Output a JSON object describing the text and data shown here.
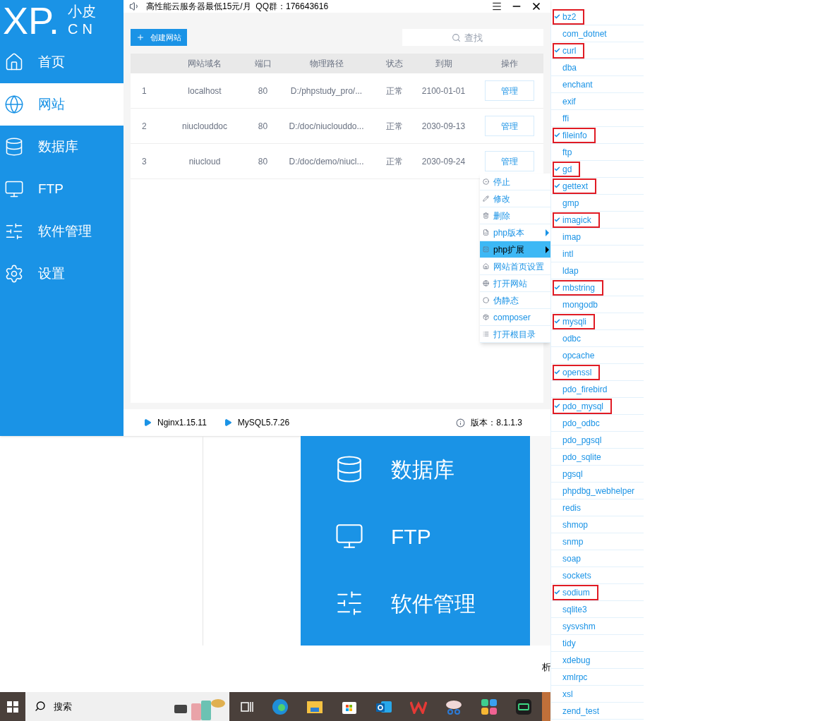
{
  "app": {
    "logo": {
      "mark": "XP.",
      "name": "小皮",
      "domain": "CN"
    },
    "notice": "高性能云服务器最低15元/月  QQ群：176643616",
    "sidebar": {
      "items": [
        {
          "label": "首页",
          "selected": false
        },
        {
          "label": "网站",
          "selected": true
        },
        {
          "label": "数据库",
          "selected": false
        },
        {
          "label": "FTP",
          "selected": false
        },
        {
          "label": "软件管理",
          "selected": false
        },
        {
          "label": "设置",
          "selected": false
        }
      ]
    },
    "toolbar": {
      "create_button": "创建网站",
      "search": {
        "placeholder": "查找"
      }
    },
    "table": {
      "columns": [
        "网站域名",
        "端口",
        "物理路径",
        "状态",
        "到期",
        "操作"
      ],
      "rows": [
        {
          "index": "1",
          "domain": "localhost",
          "port": "80",
          "path": "D:/phpstudy_pro/...",
          "status": "正常",
          "expires": "2100-01-01",
          "action": "管理"
        },
        {
          "index": "2",
          "domain": "niuclouddoc",
          "port": "80",
          "path": "D:/doc/niuclouddo...",
          "status": "正常",
          "expires": "2030-09-13",
          "action": "管理"
        },
        {
          "index": "3",
          "domain": "niucloud",
          "port": "80",
          "path": "D:/doc/demo/niucl...",
          "status": "正常",
          "expires": "2030-09-24",
          "action": "管理"
        }
      ]
    },
    "context_menu": {
      "items": [
        {
          "label": "停止",
          "selected": false,
          "submenu": false
        },
        {
          "label": "修改",
          "selected": false,
          "submenu": false
        },
        {
          "label": "删除",
          "selected": false,
          "submenu": false
        },
        {
          "label": "php版本",
          "selected": false,
          "submenu": true
        },
        {
          "label": "php扩展",
          "selected": true,
          "submenu": true
        },
        {
          "label": "网站首页设置",
          "selected": false,
          "submenu": false
        },
        {
          "label": "打开网站",
          "selected": false,
          "submenu": false
        },
        {
          "label": "伪静态",
          "selected": false,
          "submenu": false
        },
        {
          "label": "composer",
          "selected": false,
          "submenu": false
        },
        {
          "label": "打开根目录",
          "selected": false,
          "submenu": false
        }
      ]
    },
    "status_bar": {
      "services": [
        "Nginx1.15.11",
        "MySQL5.7.26"
      ],
      "version": "版本：8.1.1.3"
    }
  },
  "extensions_menu": {
    "items": [
      {
        "name": "bz2",
        "checked": true
      },
      {
        "name": "com_dotnet",
        "checked": false
      },
      {
        "name": "curl",
        "checked": true
      },
      {
        "name": "dba",
        "checked": false
      },
      {
        "name": "enchant",
        "checked": false
      },
      {
        "name": "exif",
        "checked": false
      },
      {
        "name": "ffi",
        "checked": false
      },
      {
        "name": "fileinfo",
        "checked": true
      },
      {
        "name": "ftp",
        "checked": false
      },
      {
        "name": "gd",
        "checked": true
      },
      {
        "name": "gettext",
        "checked": true
      },
      {
        "name": "gmp",
        "checked": false
      },
      {
        "name": "imagick",
        "checked": true
      },
      {
        "name": "imap",
        "checked": false
      },
      {
        "name": "intl",
        "checked": false
      },
      {
        "name": "ldap",
        "checked": false
      },
      {
        "name": "mbstring",
        "checked": true
      },
      {
        "name": "mongodb",
        "checked": false
      },
      {
        "name": "mysqli",
        "checked": true
      },
      {
        "name": "odbc",
        "checked": false
      },
      {
        "name": "opcache",
        "checked": false
      },
      {
        "name": "openssl",
        "checked": true
      },
      {
        "name": "pdo_firebird",
        "checked": false
      },
      {
        "name": "pdo_mysql",
        "checked": true
      },
      {
        "name": "pdo_odbc",
        "checked": false
      },
      {
        "name": "pdo_pgsql",
        "checked": false
      },
      {
        "name": "pdo_sqlite",
        "checked": false
      },
      {
        "name": "pgsql",
        "checked": false
      },
      {
        "name": "phpdbg_webhelper",
        "checked": false
      },
      {
        "name": "redis",
        "checked": false
      },
      {
        "name": "shmop",
        "checked": false
      },
      {
        "name": "snmp",
        "checked": false
      },
      {
        "name": "soap",
        "checked": false
      },
      {
        "name": "sockets",
        "checked": false
      },
      {
        "name": "sodium",
        "checked": true
      },
      {
        "name": "sqlite3",
        "checked": false
      },
      {
        "name": "sysvshm",
        "checked": false
      },
      {
        "name": "tidy",
        "checked": false
      },
      {
        "name": "xdebug",
        "checked": false
      },
      {
        "name": "xmlrpc",
        "checked": false
      },
      {
        "name": "xsl",
        "checked": false
      },
      {
        "name": "zend_test",
        "checked": false
      }
    ]
  },
  "background_image": {
    "items": [
      "数据库",
      "FTP",
      "软件管理"
    ]
  },
  "stray_text": "析",
  "taskbar": {
    "search": {
      "placeholder": "搜索"
    }
  }
}
